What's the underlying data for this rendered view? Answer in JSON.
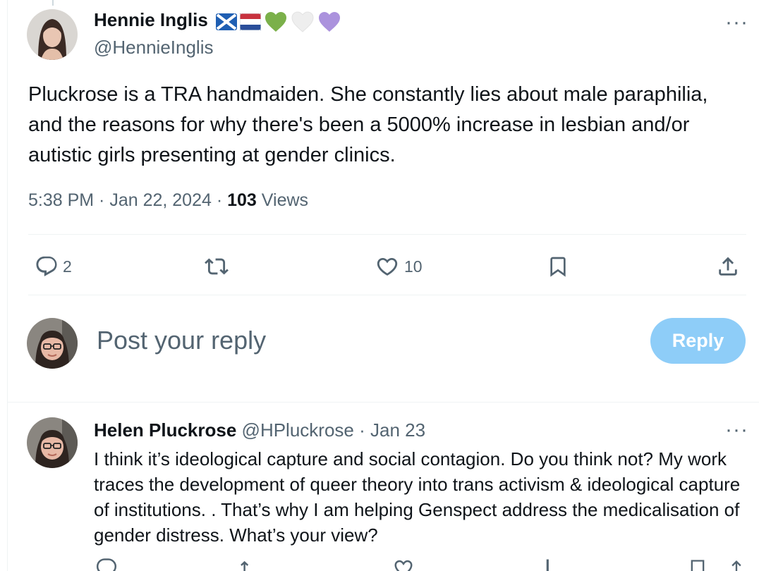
{
  "main_post": {
    "author_name": "Hennie Inglis",
    "author_handle": "@HennieInglis",
    "name_emojis": [
      "scotland-flag-icon",
      "netherlands-flag-icon",
      "green-heart-icon",
      "white-heart-icon",
      "purple-heart-icon"
    ],
    "text": "Pluckrose is a TRA handmaiden. She constantly lies about male paraphilia, and the reasons for why there's been a 5000% increase in lesbian and/or autistic girls presenting at gender clinics.",
    "time": "5:38 PM",
    "separator": " · ",
    "date": "Jan 22, 2024",
    "views_count": "103",
    "views_label": " Views",
    "more_label": "···",
    "actions": {
      "reply_count": "2",
      "retweet_count": "",
      "like_count": "10"
    }
  },
  "composer": {
    "placeholder": "Post your reply",
    "reply_button": "Reply"
  },
  "reply_post": {
    "author_name": "Helen Pluckrose",
    "author_handle": "@HPluckrose",
    "separator": " · ",
    "date": "Jan 23",
    "more_label": "···",
    "text": "I think it’s ideological capture and social contagion. Do you think not? My work traces the development of queer theory into trans activism & ideological capture of institutions. . That’s why I am helping Genspect address the medicalisation of gender distress. What’s your view?"
  },
  "colors": {
    "text": "#0f1419",
    "secondary": "#536471",
    "divider": "#eff3f4",
    "reply_button_bg": "#8ecdf8"
  }
}
